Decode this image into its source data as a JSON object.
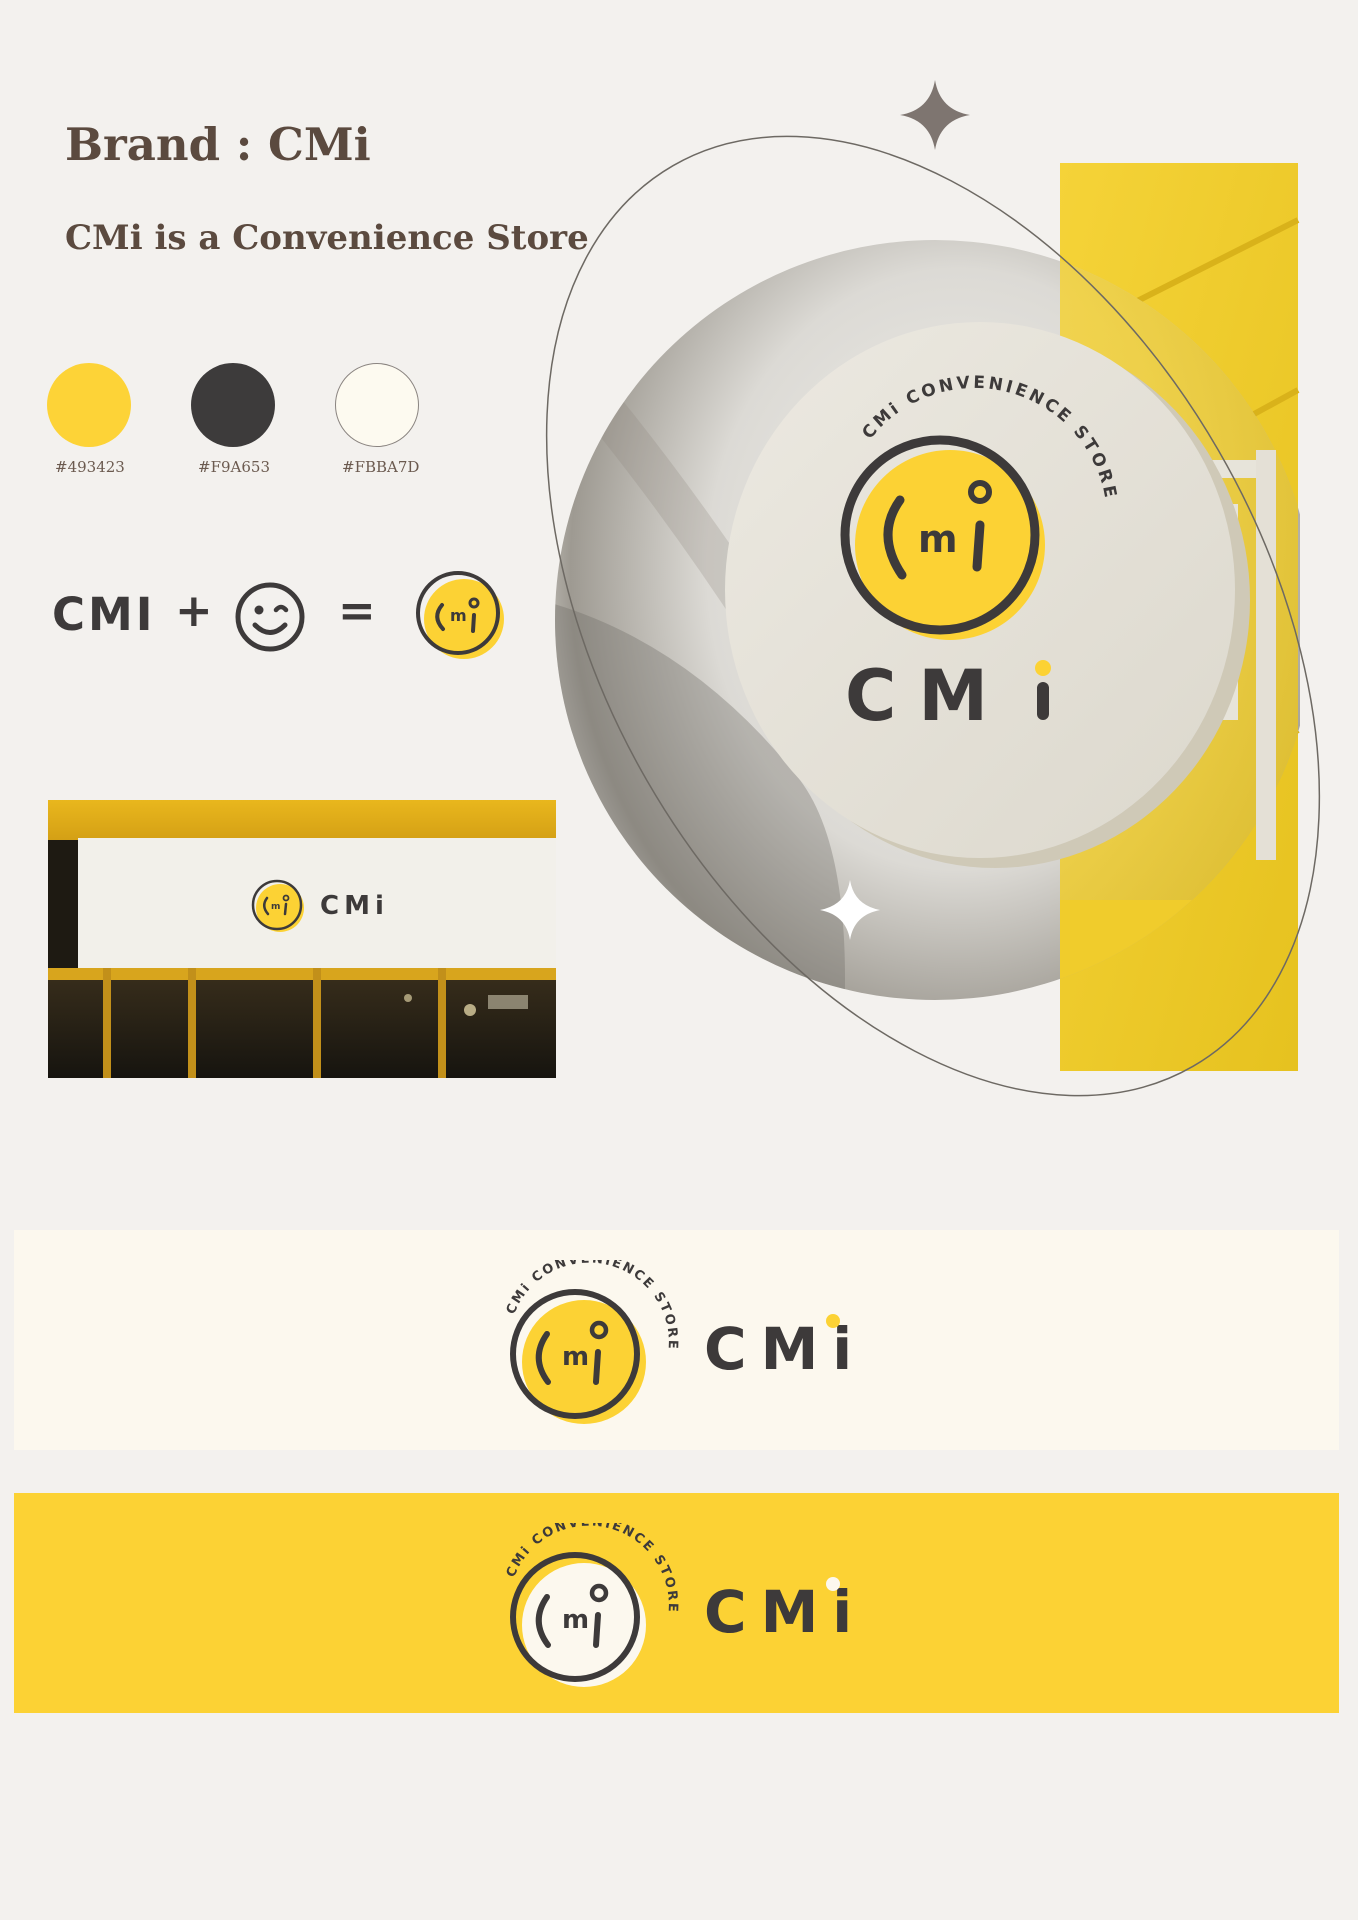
{
  "header": {
    "title": "Brand : CMi",
    "subtitle": "CMi is a Convenience Store"
  },
  "palette": [
    {
      "label": "#493423",
      "color": "#fdd337"
    },
    {
      "label": "#F9A653",
      "color": "#3d3b3b"
    },
    {
      "label": "#FBBA7D",
      "color": "#fdfaf0"
    }
  ],
  "equation": {
    "left_text": "CMI",
    "plus": "+",
    "smiley_icon": "smiley-icon",
    "equals": "="
  },
  "logo": {
    "ring_text": "CMi CONVENIENCE STORE",
    "inner_text": "Cmi",
    "wordmark": "CMi",
    "colors": {
      "yellow": "#fcd234",
      "dark": "#3d3a3a",
      "cream": "#fcf8ee"
    }
  },
  "banners": [
    {
      "background": "#fcf8ee",
      "wordmark": "CMi"
    },
    {
      "background": "#fcd234",
      "wordmark": "CMi"
    }
  ]
}
